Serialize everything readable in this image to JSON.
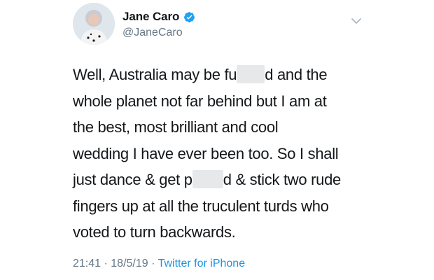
{
  "user": {
    "display_name": "Jane Caro",
    "handle": "@JaneCaro",
    "verified": true
  },
  "tweet": {
    "line1_a": "Well, Australia may be fu",
    "line1_b": "d and the",
    "line2": "whole planet not far behind but I am at",
    "line3": "the best, most brilliant and cool",
    "line4": "wedding I have ever been too. So I shall",
    "line5_a": "just dance & get p",
    "line5_b": "d & stick two rude",
    "line6": "fingers up at all the truculent turds who",
    "line7": "voted to turn backwards."
  },
  "meta": {
    "time": "21:41",
    "separator": " · ",
    "date": "18/5/19",
    "source": "Twitter for iPhone"
  },
  "colors": {
    "accent": "#1da1f2",
    "text": "#14171a",
    "secondary": "#657786"
  },
  "icons": {
    "verified": "verified-badge-icon",
    "caret": "chevron-down-icon"
  }
}
